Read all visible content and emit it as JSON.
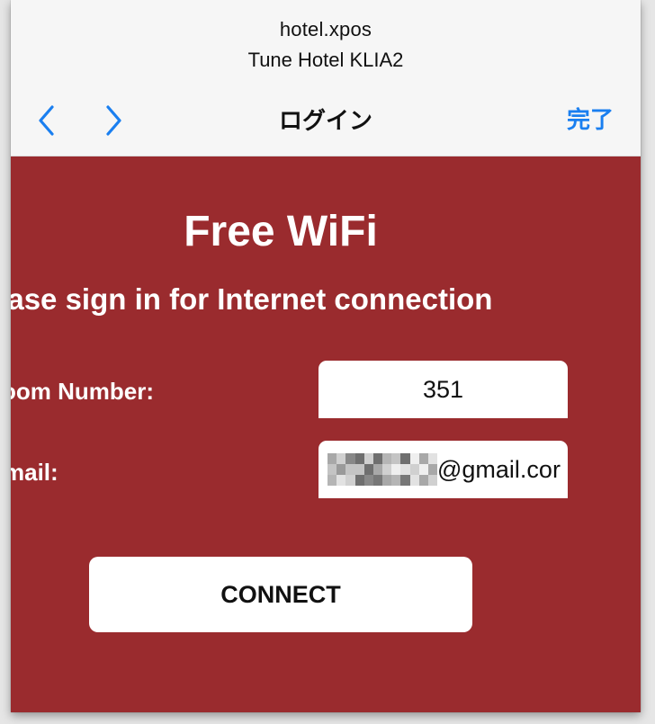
{
  "browser": {
    "domain": "hotel.xpos",
    "site_title": "Tune Hotel KLIA2",
    "nav_title": "ログイン",
    "done_label": "完了",
    "back_icon": "chevron-left-icon",
    "forward_icon": "chevron-right-icon",
    "accent_color": "#1a7ff0"
  },
  "portal": {
    "background_color": "#9a2b2e",
    "title": "Free WiFi",
    "subtitle": "ease sign in for Internet connection",
    "room_label": "oom Number:",
    "room_value": "351",
    "email_label": "mail:",
    "email_value_visible": "@gmail.cor",
    "connect_label": "CONNECT"
  }
}
